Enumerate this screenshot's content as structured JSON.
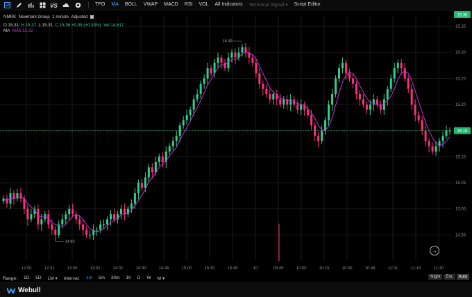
{
  "toolbar": {
    "items": [
      {
        "label": "TPO",
        "state": "normal"
      },
      {
        "label": "MA",
        "state": "active"
      },
      {
        "label": "BOLL",
        "state": "normal"
      },
      {
        "label": "VWAP",
        "state": "normal"
      },
      {
        "label": "MACD",
        "state": "normal"
      },
      {
        "label": "RSI",
        "state": "normal"
      },
      {
        "label": "VOL",
        "state": "normal"
      },
      {
        "label": "All Indicators",
        "state": "normal"
      },
      {
        "label": "Technical Signal ▾",
        "state": "dim"
      },
      {
        "label": "Script Editor",
        "state": "normal"
      }
    ],
    "icons": [
      "chart-type-icon",
      "pen-icon",
      "bar-chart-icon",
      "grid-icon",
      "vs-compare-icon",
      "cloud-icon",
      "settings-icon"
    ]
  },
  "header": {
    "ticker": "NMRK",
    "company": "Newmark Group",
    "interval": "1 minute",
    "adjust": "Adjusted",
    "o_label": "O",
    "o": "15.31",
    "h_label": "H",
    "h": "15.37",
    "l_label": "L",
    "l": "15.31",
    "c_label": "C",
    "c": "15.36",
    "change": "+0.05 (+0.33%)",
    "vol_label": "Vol",
    "vol": "14,617",
    "ma_title": "MA",
    "ma_label": "MA5",
    "ma_value": "15.32"
  },
  "annotations": {
    "high_label": "15.32",
    "low_label": "14.93"
  },
  "colors": {
    "up": "#2fcf8f",
    "down": "#ff2f7a",
    "ma": "#c233d6",
    "grid": "#1a1a1a",
    "accent": "#3ea5ff"
  },
  "chart_data": {
    "type": "candlestick",
    "y_ticks": [
      "15.36",
      "15.35",
      "15.30",
      "15.25",
      "15.20",
      "15.15",
      "15.10",
      "15.05",
      "15.00",
      "14.95"
    ],
    "x_ticks": [
      "12:00",
      "12:31",
      "13:00",
      "13:32",
      "14:01",
      "14:30",
      "14:46",
      "15:00",
      "15:30",
      "15:45",
      "10",
      "09:45",
      "10:00",
      "10:15",
      "10:30",
      "10:45",
      "11:01",
      "11:15",
      "11:30"
    ],
    "current_price": "15.36",
    "last_price": "15.15",
    "ylim": [
      14.9,
      15.37
    ],
    "closes": [
      15.02,
      15.01,
      15.03,
      15.02,
      15.03,
      15.02,
      15.0,
      14.98,
      14.99,
      15.0,
      14.97,
      14.98,
      14.99,
      14.97,
      14.96,
      14.95,
      14.97,
      14.98,
      14.99,
      15.0,
      14.99,
      14.98,
      14.97,
      14.96,
      14.95,
      14.95,
      14.96,
      14.96,
      14.97,
      14.97,
      14.98,
      14.99,
      14.98,
      14.99,
      15.0,
      14.99,
      15.0,
      15.01,
      15.03,
      15.05,
      15.04,
      15.06,
      15.08,
      15.07,
      15.09,
      15.1,
      15.09,
      15.11,
      15.12,
      15.13,
      15.14,
      15.16,
      15.17,
      15.18,
      15.19,
      15.21,
      15.22,
      15.24,
      15.25,
      15.27,
      15.26,
      15.28,
      15.29,
      15.28,
      15.27,
      15.29,
      15.3,
      15.29,
      15.3,
      15.31,
      15.3,
      15.29,
      15.28,
      15.26,
      15.24,
      15.23,
      15.22,
      15.21,
      15.22,
      15.21,
      15.2,
      15.21,
      15.2,
      15.21,
      15.2,
      15.19,
      15.2,
      15.19,
      15.18,
      15.16,
      15.14,
      15.13,
      15.15,
      15.17,
      15.2,
      15.22,
      15.25,
      15.27,
      15.28,
      15.26,
      15.25,
      15.24,
      15.22,
      15.21,
      15.2,
      15.19,
      15.2,
      15.21,
      15.2,
      15.19,
      15.21,
      15.23,
      15.25,
      15.27,
      15.28,
      15.27,
      15.25,
      15.23,
      15.2,
      15.18,
      15.17,
      15.15,
      15.13,
      15.12,
      15.11,
      15.12,
      15.13,
      15.14,
      15.15,
      15.15
    ]
  },
  "bottom": {
    "range_label": "Range:",
    "ranges": [
      "1D",
      "5D",
      "1M ▾"
    ],
    "interval_label": "Interval:",
    "intervals": [
      "1m",
      "5m",
      "30m",
      "1h",
      "D",
      "W",
      "M ▾"
    ],
    "active_interval": "1m",
    "sessions": [
      "Night",
      "Ext.",
      "Auto"
    ]
  },
  "footer": {
    "brand": "Webull"
  }
}
